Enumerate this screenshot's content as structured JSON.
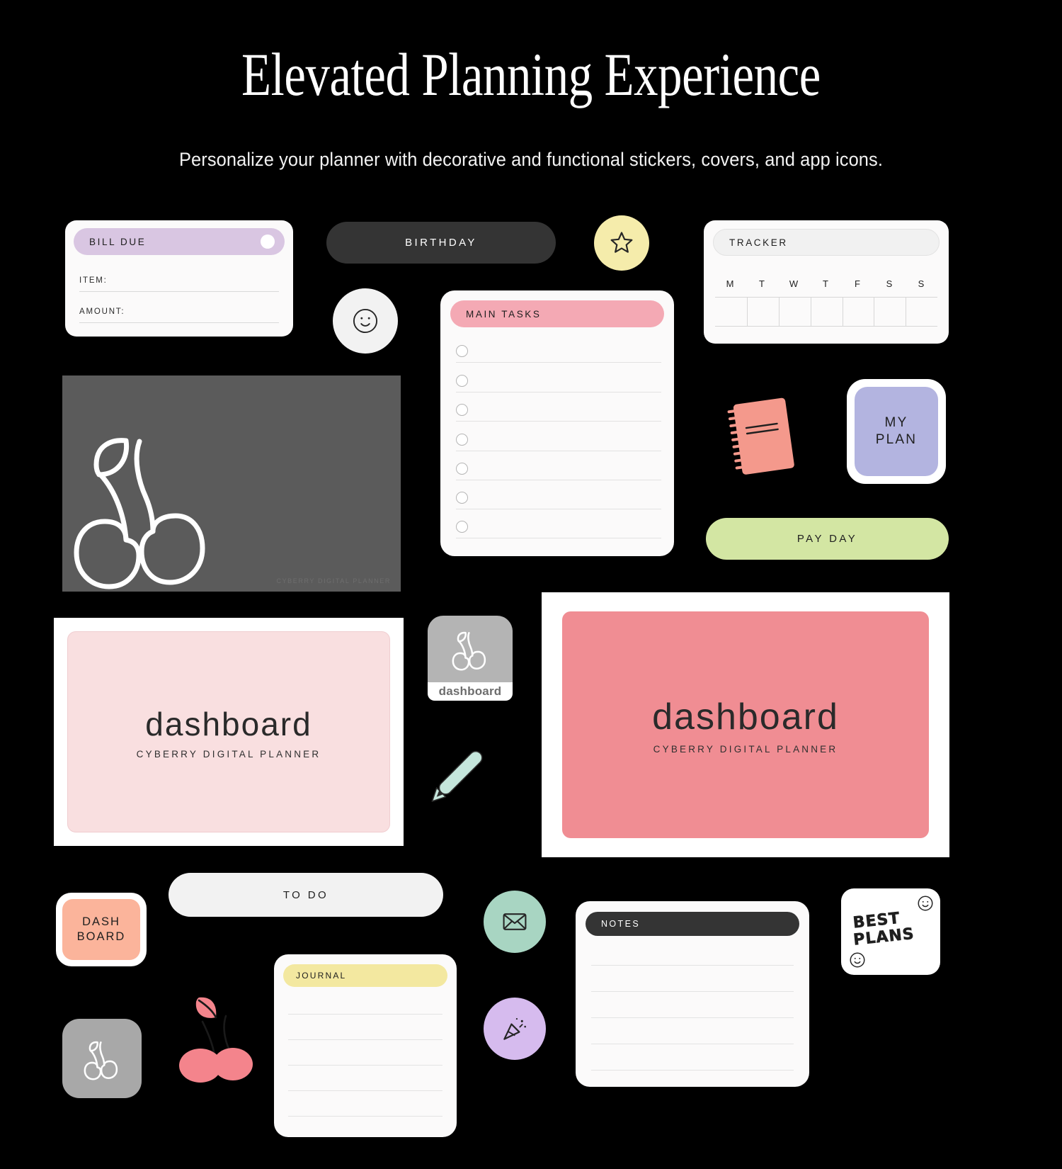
{
  "header": {
    "title": "Elevated Planning Experience",
    "subtitle": "Personalize your planner with decorative and functional stickers, covers, and app icons."
  },
  "colors": {
    "background": "#000000",
    "card": "#fbfafa",
    "lavender": "#d9c6e2",
    "pink": "#f4a9b4",
    "salmon": "#f4998c",
    "peach": "#fbb49b",
    "green": "#d3e6a3",
    "yellow": "#f3e8a0",
    "periwinkle": "#b3b4e0",
    "mint": "#a8d5c2",
    "lilac": "#d6bbee",
    "dark": "#343434",
    "gray_cover": "#5b5b5b",
    "pink_cover": "#f9dfe0",
    "coral_cover": "#f08d93"
  },
  "stickers": {
    "bill_due": {
      "header": "BILL DUE",
      "fields": [
        "ITEM:",
        "AMOUNT:"
      ]
    },
    "birthday_pill": {
      "label": "BIRTHDAY"
    },
    "star_badge": {
      "icon": "star-icon"
    },
    "smiley_badge": {
      "icon": "smiley-face-icon"
    },
    "tracker": {
      "header": "TRACKER",
      "days": [
        "M",
        "T",
        "W",
        "T",
        "F",
        "S",
        "S"
      ]
    },
    "main_tasks": {
      "header": "MAIN TASKS",
      "row_count": 7
    },
    "notebook_sticker": {
      "icon": "spiral-notebook-icon"
    },
    "my_plan_icon": {
      "label": "MY\nPLAN",
      "line1": "MY",
      "line2": "PLAN"
    },
    "pay_day_pill": {
      "label": "PAY DAY"
    },
    "cherry_cover": {
      "caption": "CYBERRY DIGITAL PLANNER",
      "icon": "cherry-outline-icon"
    },
    "dashboard_cover_pink": {
      "title": "dashboard",
      "subtitle": "CYBERRY DIGITAL PLANNER"
    },
    "dashboard_cover_coral": {
      "title": "dashboard",
      "subtitle": "CYBERRY DIGITAL PLANNER"
    },
    "dashboard_app_icon": {
      "label": "dashboard",
      "icon": "cherry-outline-icon"
    },
    "pencil_sticker": {
      "icon": "pencil-icon"
    },
    "dash_board_icon": {
      "line1": "DASH",
      "line2": "BOARD"
    },
    "to_do_pill": {
      "label": "TO DO"
    },
    "mail_badge": {
      "icon": "envelope-icon"
    },
    "confetti_badge": {
      "icon": "party-popper-icon"
    },
    "notes": {
      "header": "NOTES",
      "line_count": 5
    },
    "journal": {
      "header": "JOURNAL",
      "line_count": 5
    },
    "best_plans": {
      "line1": "BEST",
      "line2": "PLANS",
      "icons": [
        "smiley-face-icon",
        "smiley-face-icon"
      ]
    },
    "cherry_app_icon_gray": {
      "icon": "cherry-outline-icon"
    },
    "cherry_fruit_sticker": {
      "icon": "cherry-filled-icon"
    }
  }
}
